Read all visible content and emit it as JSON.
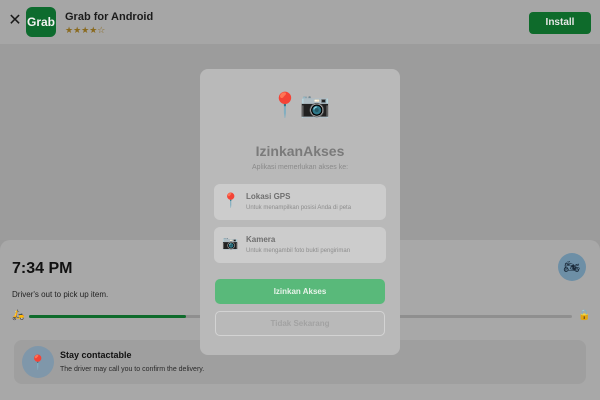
{
  "app_banner": {
    "close_glyph": "✕",
    "logo_text": "Grab",
    "title": "Grab for Android",
    "rating_stars": "★★★★☆",
    "install_label": "Install"
  },
  "trip": {
    "eta": "7:34 PM",
    "status": "Driver's out to pick up item.",
    "progress_fraction": 0.29,
    "contact": {
      "title": "Stay contactable",
      "subtitle": "The driver may call you to confirm the delivery."
    }
  },
  "modal": {
    "title": "IzinkanAkses",
    "subtitle": "Aplikasi memerlukan akses ke:",
    "permissions": [
      {
        "icon": "location-pin-icon",
        "title": "Lokasi GPS",
        "description": "Untuk menampilkan posisi Anda di peta"
      },
      {
        "icon": "camera-icon",
        "title": "Kamera",
        "description": "Untuk mengambil foto bukti pengiriman"
      }
    ],
    "allow_label": "Izinkan Akses",
    "later_label": "Tidak Sekarang"
  },
  "colors": {
    "brand_green": "#0e6b2b",
    "allow_green": "#59b97a",
    "overlay_gray": "#9a9a9a"
  }
}
